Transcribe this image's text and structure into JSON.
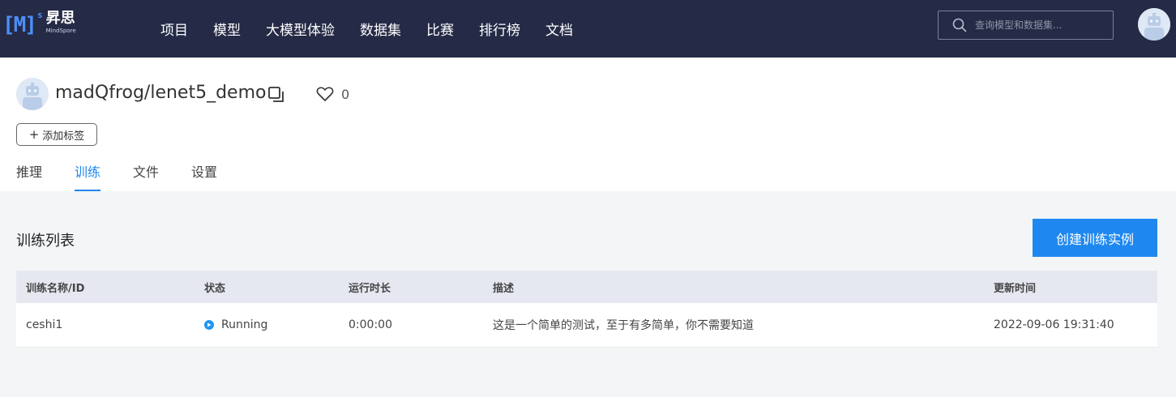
{
  "logo": {
    "mark": "[M]",
    "superscript": "s",
    "name": "昇思",
    "sub": "MindSpore"
  },
  "nav": {
    "items": [
      {
        "label": "项目"
      },
      {
        "label": "模型"
      },
      {
        "label": "大模型体验"
      },
      {
        "label": "数据集"
      },
      {
        "label": "比赛"
      },
      {
        "label": "排行榜"
      },
      {
        "label": "文档"
      }
    ]
  },
  "search": {
    "placeholder": "查询模型和数据集...",
    "icon": "search-icon"
  },
  "repo": {
    "name": "madQfrog/lenet5_demo",
    "likes": "0",
    "add_tag_label": "添加标签"
  },
  "tabs": [
    {
      "label": "推理",
      "active": false
    },
    {
      "label": "训练",
      "active": true
    },
    {
      "label": "文件",
      "active": false
    },
    {
      "label": "设置",
      "active": false
    }
  ],
  "main": {
    "title": "训练列表",
    "create_button": "创建训练实例",
    "table": {
      "headers": [
        "训练名称/ID",
        "状态",
        "运行时长",
        "描述",
        "更新时间"
      ],
      "rows": [
        {
          "name": "ceshi1",
          "status": "Running",
          "duration": "0:00:00",
          "description": "这是一个简单的测试，至于有多简单，你不需要知道",
          "updated": "2022-09-06 19:31:40"
        }
      ]
    }
  },
  "colors": {
    "nav_bg": "#252a46",
    "accent": "#1e88f0",
    "header_row": "#e6e8f1",
    "page_bg": "#f4f5f7"
  }
}
